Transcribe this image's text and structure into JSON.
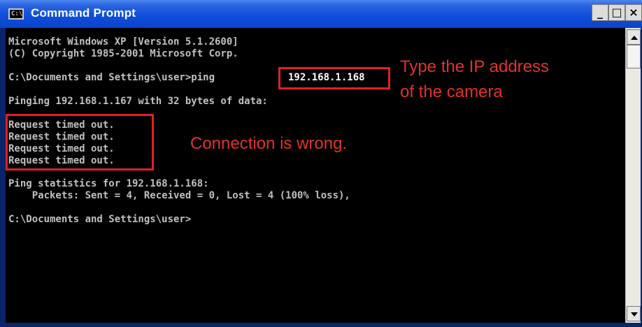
{
  "window": {
    "title": "Command Prompt",
    "icon_label": "C:\\",
    "buttons": {
      "minimize": "_",
      "maximize": "□",
      "close": "×"
    }
  },
  "console": {
    "lines": [
      "Microsoft Windows XP [Version 5.1.2600]",
      "(C) Copyright 1985-2001 Microsoft Corp.",
      "",
      "C:\\Documents and Settings\\user>ping ",
      "",
      "Pinging 192.168.1.167 with 32 bytes of data:",
      "",
      "Request timed out.",
      "Request timed out.",
      "Request timed out.",
      "Request timed out.",
      "",
      "Ping statistics for 192.168.1.168:",
      "    Packets: Sent = 4, Received = 0, Lost = 4 (100% loss),",
      "",
      "C:\\Documents and Settings\\user>"
    ],
    "ping_target": "192.168.1.168"
  },
  "annotations": {
    "ip_hint_line1": "Type the IP address",
    "ip_hint_line2": "of the camera",
    "error_hint": "Connection is wrong."
  },
  "colors": {
    "console_bg": "#000000",
    "console_text": "#c0c0c0",
    "annotation_red": "#e0332b",
    "titlebar_blue": "#0f4fdc"
  }
}
